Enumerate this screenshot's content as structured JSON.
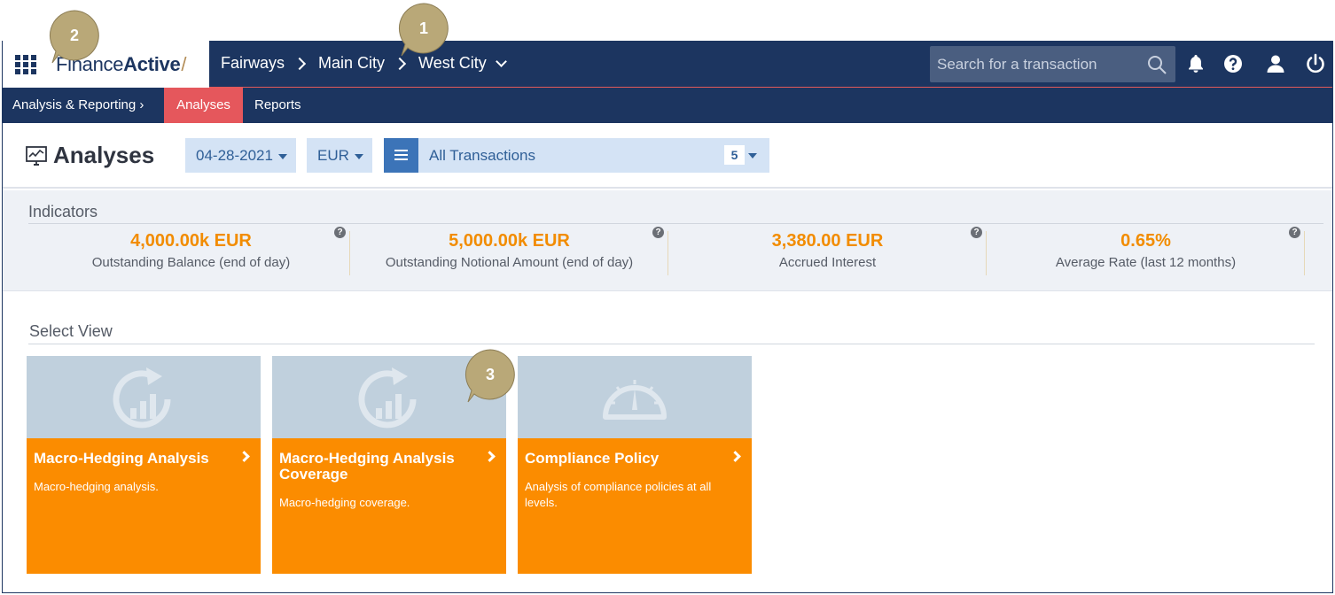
{
  "topbar": {
    "logo": {
      "light": "Finance",
      "bold": "Active"
    },
    "breadcrumb": [
      "Fairways",
      "Main City",
      "West City"
    ],
    "search_placeholder": "Search for a transaction",
    "icons": [
      "apps-grid-icon",
      "search-icon",
      "bell-icon",
      "help-icon",
      "user-icon",
      "power-icon"
    ]
  },
  "subnav": {
    "section": "Analysis & Reporting",
    "tabs": [
      {
        "label": "Analyses",
        "active": true
      },
      {
        "label": "Reports",
        "active": false
      }
    ]
  },
  "header": {
    "title": "Analyses",
    "date": "04-28-2021",
    "currency": "EUR",
    "transactions_label": "All Transactions",
    "transactions_count": "5"
  },
  "indicators": {
    "label": "Indicators",
    "items": [
      {
        "value": "4,000.00k EUR",
        "label": "Outstanding Balance (end of day)"
      },
      {
        "value": "5,000.00k EUR",
        "label": "Outstanding Notional Amount (end of day)"
      },
      {
        "value": "3,380.00 EUR",
        "label": "Accrued Interest"
      },
      {
        "value": "0.65%",
        "label": "Average Rate (last 12 months)"
      }
    ],
    "help_glyph": "?"
  },
  "views": {
    "label": "Select View",
    "cards": [
      {
        "title": "Macro-Hedging Analysis",
        "description": "Macro-hedging analysis.",
        "icon": "refresh-chart-icon"
      },
      {
        "title": "Macro-Hedging Analysis Coverage",
        "description": "Macro-hedging coverage.",
        "icon": "refresh-chart-icon"
      },
      {
        "title": "Compliance Policy",
        "description": "Analysis of compliance policies at all levels.",
        "icon": "gauge-icon"
      }
    ]
  },
  "callouts": [
    "1",
    "2",
    "3"
  ],
  "colors": {
    "navy": "#1c3560",
    "accent_red": "#e5575c",
    "orange": "#fb8c00",
    "kpi_orange": "#f28c00",
    "callout_tan": "#b9a878",
    "pill_bg": "#d4e3f5"
  }
}
